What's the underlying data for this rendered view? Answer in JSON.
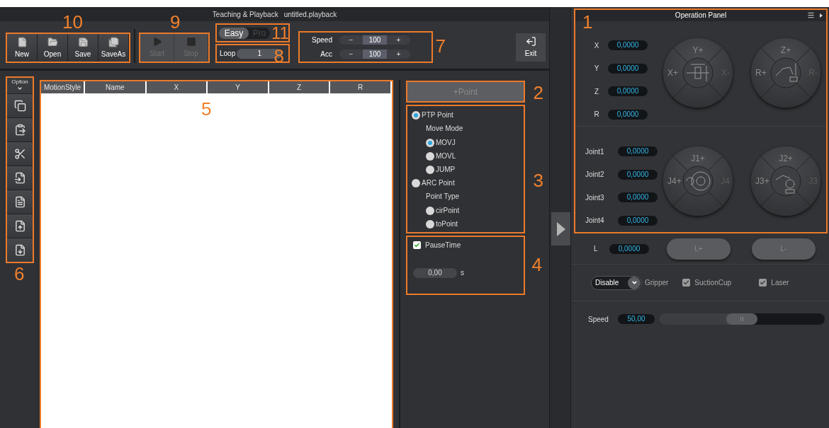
{
  "title": "Teaching & Playback",
  "file_name": "untitled.playback",
  "file_buttons": {
    "callout": "10",
    "items": [
      {
        "label": "New"
      },
      {
        "label": "Open"
      },
      {
        "label": "Save"
      },
      {
        "label": "SaveAs"
      }
    ]
  },
  "run_buttons": {
    "callout": "9",
    "items": [
      {
        "label": "Start",
        "disabled": true
      },
      {
        "label": "Stop",
        "disabled": true
      }
    ]
  },
  "mode_toggle": {
    "callout": "11",
    "items": [
      {
        "label": "Easy",
        "selected": true
      },
      {
        "label": "Pro",
        "selected": false
      }
    ]
  },
  "loop": {
    "callout": "8",
    "label": "Loop",
    "value": "1"
  },
  "steppers": {
    "callout": "7",
    "items": [
      {
        "label": "Speed",
        "minus": "−",
        "value": "100",
        "plus": "+"
      },
      {
        "label": "Acc",
        "minus": "−",
        "value": "100",
        "plus": "+"
      }
    ]
  },
  "exit_button": {
    "label": "Exit"
  },
  "option_column": {
    "callout": "6",
    "label": "Option"
  },
  "table": {
    "callout": "5",
    "columns": [
      "MotionStyle",
      "Name",
      "X",
      "Y",
      "Z",
      "R"
    ]
  },
  "add_point": {
    "callout": "2",
    "label": "+Point"
  },
  "point_settings": {
    "callout": "3",
    "groups": [
      {
        "label": "PTP Point",
        "selected": true,
        "sub_label": "Move Mode",
        "options": [
          {
            "label": "MOVJ",
            "selected": true
          },
          {
            "label": "MOVL",
            "selected": false
          },
          {
            "label": "JUMP",
            "selected": false
          }
        ]
      },
      {
        "label": "ARC Point",
        "selected": false,
        "sub_label": "Point Type",
        "options": [
          {
            "label": "cirPoint",
            "selected": false
          },
          {
            "label": "toPoint",
            "selected": false
          }
        ]
      }
    ]
  },
  "pause_time": {
    "callout": "4",
    "label": "PauseTime",
    "checked": true,
    "value": "0,00",
    "unit": "s"
  },
  "operation_panel": {
    "callout": "1",
    "title": "Operation Panel",
    "coordinates": [
      {
        "label": "X",
        "value": "0,0000"
      },
      {
        "label": "Y",
        "value": "0,0000"
      },
      {
        "label": "Z",
        "value": "0,0000"
      },
      {
        "label": "R",
        "value": "0,0000"
      }
    ],
    "coordinate_pads": [
      {
        "kind": "xy",
        "up": "Y+",
        "left": "X+",
        "right": "X-"
      },
      {
        "kind": "zr",
        "up": "Z+",
        "left": "R+",
        "right": "R-"
      }
    ],
    "joints": [
      {
        "label": "Joint1",
        "value": "0,0000"
      },
      {
        "label": "Joint2",
        "value": "0,0000"
      },
      {
        "label": "Joint3",
        "value": "0,0000"
      },
      {
        "label": "Joint4",
        "value": "0,0000"
      }
    ],
    "joint_pads": [
      {
        "kind": "j14",
        "up": "J1+",
        "left": "J4+",
        "right": "J4"
      },
      {
        "kind": "j23",
        "up": "J2+",
        "left": "J3+",
        "right": "J3"
      }
    ]
  },
  "l_axis": {
    "label": "L",
    "value": "0,0000",
    "buttons": [
      "L+",
      "L-"
    ]
  },
  "gripper": {
    "value": "Disable",
    "label": "Gripper"
  },
  "tools": [
    {
      "label": "SuctionCup",
      "checked": true
    },
    {
      "label": "Laser",
      "checked": true
    }
  ],
  "jog_speed": {
    "label": "Speed",
    "value": "50,00",
    "level": 0.5
  }
}
